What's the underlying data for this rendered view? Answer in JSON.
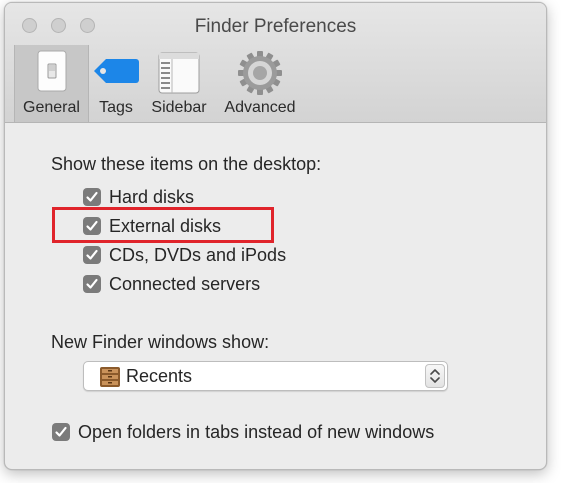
{
  "window": {
    "title": "Finder Preferences"
  },
  "tabs": [
    {
      "label": "General",
      "icon": "light-switch-icon",
      "selected": true
    },
    {
      "label": "Tags",
      "icon": "tag-icon",
      "selected": false
    },
    {
      "label": "Sidebar",
      "icon": "sidebar-icon",
      "selected": false
    },
    {
      "label": "Advanced",
      "icon": "gear-icon",
      "selected": false
    }
  ],
  "desktop": {
    "heading": "Show these items on the desktop:",
    "items": [
      {
        "label": "Hard disks",
        "checked": true
      },
      {
        "label": "External disks",
        "checked": true,
        "highlighted": true
      },
      {
        "label": "CDs, DVDs and iPods",
        "checked": true
      },
      {
        "label": "Connected servers",
        "checked": true
      }
    ]
  },
  "new_window": {
    "heading": "New Finder windows show:",
    "selected": "Recents",
    "icon": "recents-drawer-icon"
  },
  "tabs_option": {
    "label": "Open folders in tabs instead of new windows",
    "checked": true
  },
  "colors": {
    "highlight": "#e0242b",
    "tag_blue": "#1c86e8",
    "checkbox": "#7b7b7b"
  }
}
